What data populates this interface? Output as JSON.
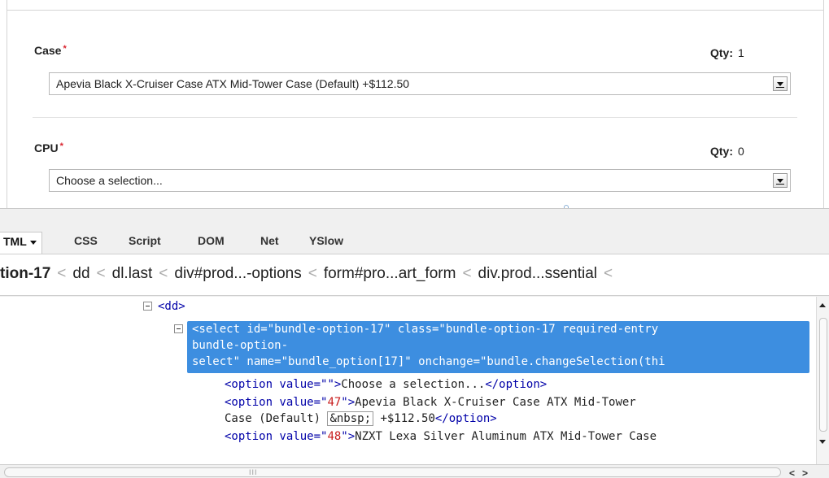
{
  "options": [
    {
      "label": "Case",
      "required_mark": "*",
      "qty_label": "Qty:",
      "qty_value": "1",
      "selected": "Apevia Black X-Cruiser Case ATX Mid-Tower Case (Default)  +$112.50"
    },
    {
      "label": "CPU",
      "required_mark": "*",
      "qty_label": "Qty:",
      "qty_value": "0",
      "selected": "Choose a selection..."
    }
  ],
  "firebug": {
    "tabs": [
      {
        "label": "TML",
        "active": true
      },
      {
        "label": "CSS"
      },
      {
        "label": "Script"
      },
      {
        "label": "DOM"
      },
      {
        "label": "Net"
      },
      {
        "label": "YSlow"
      }
    ],
    "breadcrumb": [
      "tion-17",
      "dd",
      "dl.last",
      "div#prod...-options",
      "form#pro...art_form",
      "div.prod...ssential",
      "<"
    ],
    "breadcrumb_sep": "<",
    "code": {
      "dd_open": "<dd>",
      "select_line1": "<select id=\"bundle-option-17\" class=\"bundle-option-17 required-entry",
      "select_line2": "bundle-option-",
      "select_line3": "select\" name=\"bundle_option[17]\" onchange=\"bundle.changeSelection(thi",
      "opt1_open": "<option value=\"",
      "opt1_val": "",
      "opt1_mid": "\">",
      "opt1_text": "Choose a selection...",
      "opt_close": "</option>",
      "opt2_open": "<option value=\"",
      "opt2_val": "47",
      "opt2_mid": "\">",
      "opt2_text": "Apevia Black X-Cruiser Case ATX Mid-Tower",
      "opt2_text2": "Case (Default) ",
      "opt2_entity": "&nbsp;",
      "opt2_price": " +$112.50",
      "opt3_open": "<option value=\"",
      "opt3_val": "48",
      "opt3_mid": "\">",
      "opt3_text": "NZXT Lexa Silver Aluminum ATX Mid-Tower Case"
    },
    "hscroll_grip": "III",
    "hscroll_left": "<",
    "hscroll_right": ">"
  }
}
